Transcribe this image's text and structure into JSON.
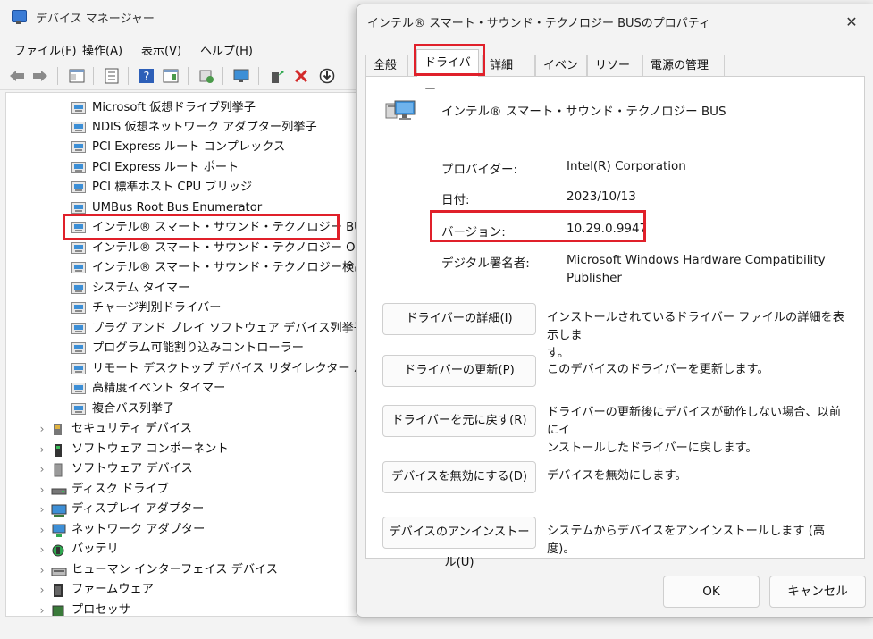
{
  "device_manager": {
    "title": "デバイス マネージャー",
    "menu": [
      "ファイル(F)",
      "操作(A)",
      "表示(V)",
      "ヘルプ(H)"
    ],
    "toolbar_icons": [
      "back-icon",
      "forward-icon",
      "properties-pane-icon",
      "list-view-icon",
      "help-icon",
      "action-view-icon",
      "scan-icon",
      "monitor-icon",
      "update-driver-icon",
      "uninstall-icon",
      "download-icon"
    ],
    "tree": [
      {
        "label": "Microsoft 仮想ドライブ列挙子",
        "icon": "system-device-icon",
        "level": 2
      },
      {
        "label": "NDIS 仮想ネットワーク アダプター列挙子",
        "icon": "system-device-icon",
        "level": 2
      },
      {
        "label": "PCI Express ルート コンプレックス",
        "icon": "system-device-icon",
        "level": 2
      },
      {
        "label": "PCI Express ルート ポート",
        "icon": "system-device-icon",
        "level": 2
      },
      {
        "label": "PCI 標準ホスト CPU ブリッジ",
        "icon": "system-device-icon",
        "level": 2
      },
      {
        "label": "UMBus Root Bus Enumerator",
        "icon": "system-device-icon",
        "level": 2
      },
      {
        "label": "インテル® スマート・サウンド・テクノロジー BUS",
        "icon": "system-device-icon",
        "level": 2,
        "highlighted": true
      },
      {
        "label": "インテル® スマート・サウンド・テクノロジー OED",
        "icon": "system-device-icon",
        "level": 2
      },
      {
        "label": "インテル® スマート・サウンド・テクノロジー検出確認",
        "icon": "system-device-icon",
        "level": 2
      },
      {
        "label": "システム タイマー",
        "icon": "system-device-icon",
        "level": 2
      },
      {
        "label": "チャージ判別ドライバー",
        "icon": "system-device-icon",
        "level": 2
      },
      {
        "label": "プラグ アンド プレイ ソフトウェア デバイス列挙子",
        "icon": "system-device-icon",
        "level": 2
      },
      {
        "label": "プログラム可能割り込みコントローラー",
        "icon": "system-device-icon",
        "level": 2
      },
      {
        "label": "リモート デスクトップ デバイス リダイレクター バス",
        "icon": "system-device-icon",
        "level": 2
      },
      {
        "label": "高精度イベント タイマー",
        "icon": "system-device-icon",
        "level": 2
      },
      {
        "label": "複合バス列挙子",
        "icon": "system-device-icon",
        "level": 2
      },
      {
        "label": "セキュリティ デバイス",
        "icon": "security-device-icon",
        "level": 1
      },
      {
        "label": "ソフトウェア コンポーネント",
        "icon": "software-component-icon",
        "level": 1
      },
      {
        "label": "ソフトウェア デバイス",
        "icon": "software-device-icon",
        "level": 1
      },
      {
        "label": "ディスク ドライブ",
        "icon": "disk-drive-icon",
        "level": 1
      },
      {
        "label": "ディスプレイ アダプター",
        "icon": "display-adapter-icon",
        "level": 1
      },
      {
        "label": "ネットワーク アダプター",
        "icon": "network-adapter-icon",
        "level": 1
      },
      {
        "label": "バッテリ",
        "icon": "battery-icon",
        "level": 1
      },
      {
        "label": "ヒューマン インターフェイス デバイス",
        "icon": "hid-icon",
        "level": 1
      },
      {
        "label": "ファームウェア",
        "icon": "firmware-icon",
        "level": 1
      },
      {
        "label": "プロセッサ",
        "icon": "processor-icon",
        "level": 1
      }
    ],
    "expand_glyph": "›"
  },
  "dialog": {
    "title": "インテル® スマート・サウンド・テクノロジー BUSのプロパティ",
    "close_glyph": "✕",
    "tabs": [
      "全般",
      "ドライバー",
      "詳細",
      "イベント",
      "リソース",
      "電源の管理"
    ],
    "active_tab": "ドライバー",
    "device_name": "インテル® スマート・サウンド・テクノロジー BUS",
    "info": {
      "provider_label": "プロバイダー:",
      "provider_value": "Intel(R) Corporation",
      "date_label": "日付:",
      "date_value": "2023/10/13",
      "version_label": "バージョン:",
      "version_value": "10.29.0.9947",
      "signer_label": "デジタル署名者:",
      "signer_value_line1": "Microsoft Windows Hardware Compatibility",
      "signer_value_line2": "Publisher"
    },
    "actions": [
      {
        "button": "ドライバーの詳細(I)",
        "desc_line1": "インストールされているドライバー ファイルの詳細を表示しま",
        "desc_line2": "す。"
      },
      {
        "button": "ドライバーの更新(P)",
        "desc_line1": "このデバイスのドライバーを更新します。",
        "desc_line2": ""
      },
      {
        "button": "ドライバーを元に戻す(R)",
        "desc_line1": "ドライバーの更新後にデバイスが動作しない場合、以前にイ",
        "desc_line2": "ンストールしたドライバーに戻します。"
      },
      {
        "button": "デバイスを無効にする(D)",
        "desc_line1": "デバイスを無効にします。",
        "desc_line2": ""
      },
      {
        "button": "デバイスのアンインストール(U)",
        "desc_line1": "システムからデバイスをアンインストールします (高度)。",
        "desc_line2": ""
      }
    ],
    "ok": "OK",
    "cancel": "キャンセル"
  },
  "colors": {
    "highlight_box": "#e0202a",
    "window_bg": "#f3f3f3",
    "panel_bg": "#ffffff"
  }
}
